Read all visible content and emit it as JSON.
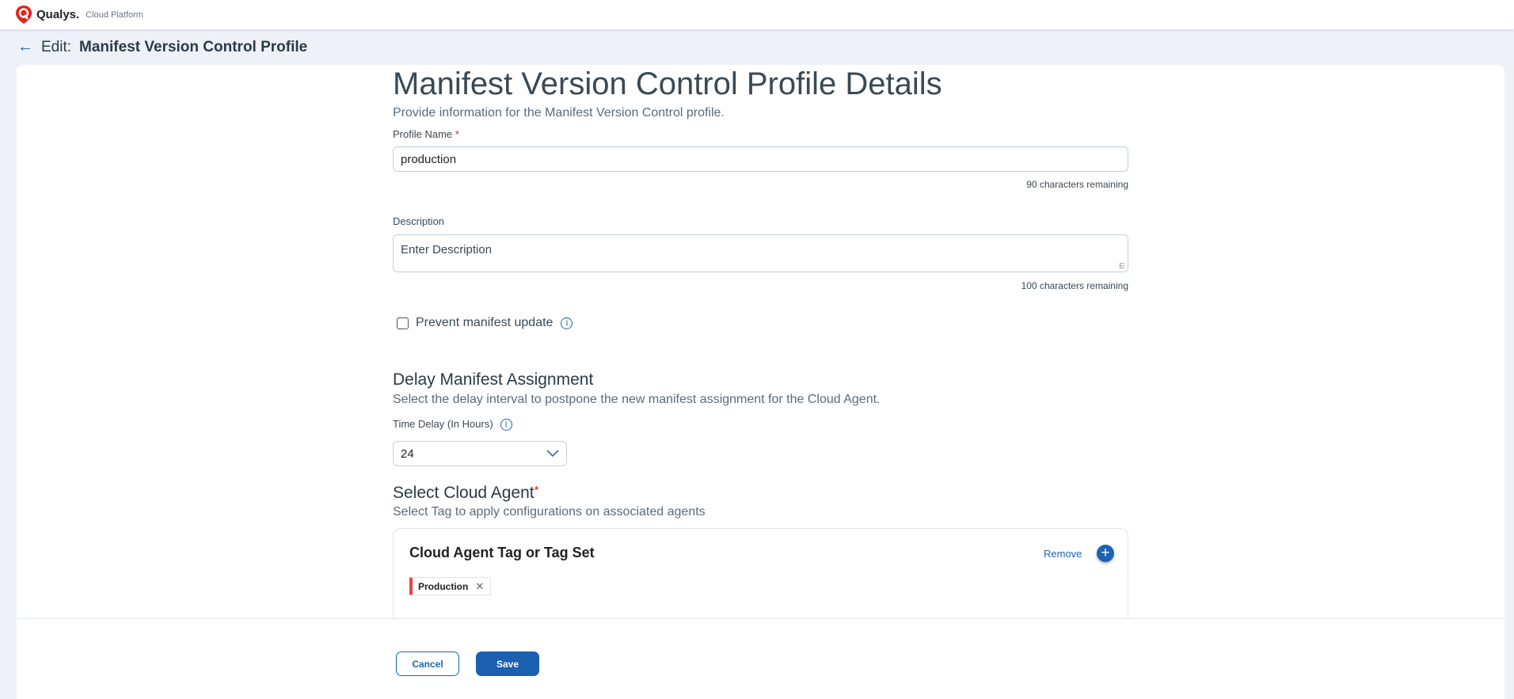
{
  "header": {
    "brand": "Qualys.",
    "brand_sub": "Cloud Platform"
  },
  "titlebar": {
    "edit": "Edit:",
    "title": "Manifest Version Control Profile"
  },
  "form": {
    "title": "Manifest Version Control Profile Details",
    "subtitle": "Provide information for the Manifest Version Control profile.",
    "profile_name_label": "Profile Name",
    "required_mark": "*",
    "profile_name_value": "production",
    "profile_name_remaining": "90 characters remaining",
    "description_label": "Description",
    "description_placeholder": "Enter Description",
    "description_remaining": "100 characters remaining",
    "prevent_update_label": "Prevent manifest update",
    "prevent_update_checked": false,
    "info_glyph": "i"
  },
  "delay": {
    "heading": "Delay Manifest Assignment",
    "subtitle": "Select the delay interval to postpone the new manifest assignment for the Cloud Agent.",
    "label": "Time Delay (In Hours)",
    "value": "24"
  },
  "agent": {
    "heading": "Select Cloud Agent",
    "subtitle": "Select Tag to apply configurations on associated agents",
    "card_title": "Cloud Agent Tag or Tag Set",
    "remove": "Remove",
    "tags": [
      {
        "label": "Production",
        "color": "#e8453c"
      }
    ]
  },
  "footer": {
    "cancel": "Cancel",
    "save": "Save"
  }
}
